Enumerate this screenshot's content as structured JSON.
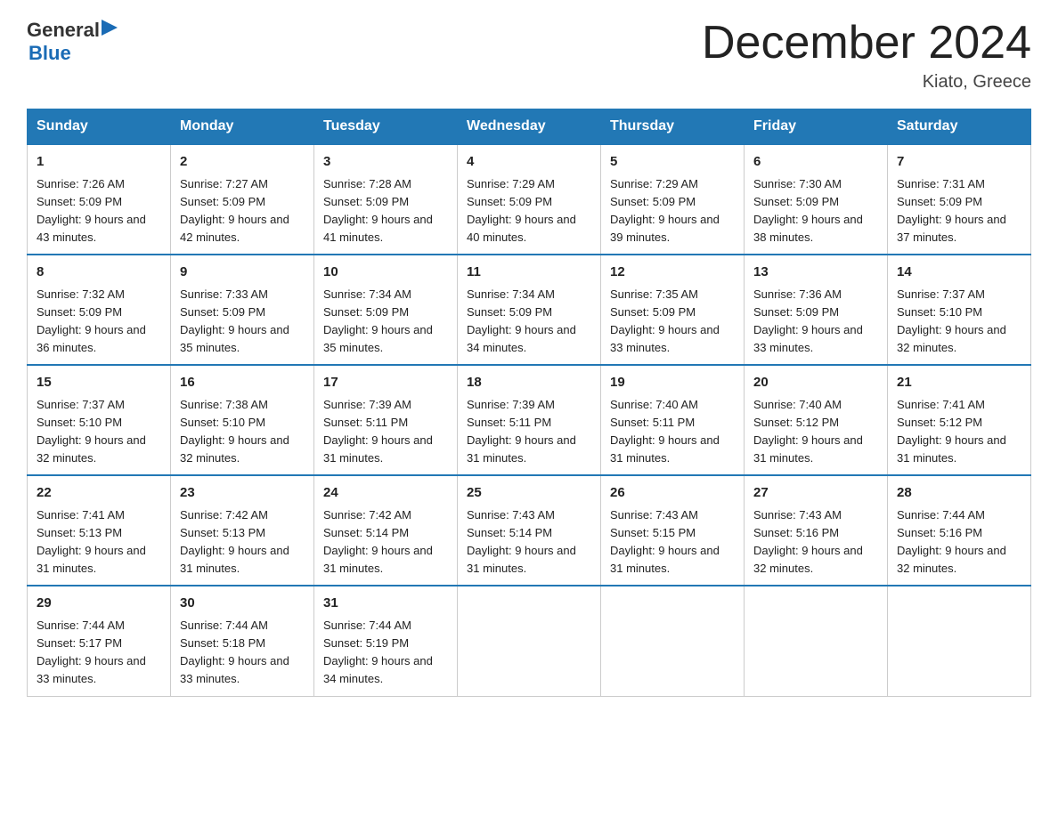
{
  "header": {
    "logo_general": "General",
    "logo_blue": "Blue",
    "title": "December 2024",
    "subtitle": "Kiato, Greece"
  },
  "columns": [
    "Sunday",
    "Monday",
    "Tuesday",
    "Wednesday",
    "Thursday",
    "Friday",
    "Saturday"
  ],
  "weeks": [
    [
      {
        "day": "1",
        "sunrise": "7:26 AM",
        "sunset": "5:09 PM",
        "daylight": "9 hours and 43 minutes."
      },
      {
        "day": "2",
        "sunrise": "7:27 AM",
        "sunset": "5:09 PM",
        "daylight": "9 hours and 42 minutes."
      },
      {
        "day": "3",
        "sunrise": "7:28 AM",
        "sunset": "5:09 PM",
        "daylight": "9 hours and 41 minutes."
      },
      {
        "day": "4",
        "sunrise": "7:29 AM",
        "sunset": "5:09 PM",
        "daylight": "9 hours and 40 minutes."
      },
      {
        "day": "5",
        "sunrise": "7:29 AM",
        "sunset": "5:09 PM",
        "daylight": "9 hours and 39 minutes."
      },
      {
        "day": "6",
        "sunrise": "7:30 AM",
        "sunset": "5:09 PM",
        "daylight": "9 hours and 38 minutes."
      },
      {
        "day": "7",
        "sunrise": "7:31 AM",
        "sunset": "5:09 PM",
        "daylight": "9 hours and 37 minutes."
      }
    ],
    [
      {
        "day": "8",
        "sunrise": "7:32 AM",
        "sunset": "5:09 PM",
        "daylight": "9 hours and 36 minutes."
      },
      {
        "day": "9",
        "sunrise": "7:33 AM",
        "sunset": "5:09 PM",
        "daylight": "9 hours and 35 minutes."
      },
      {
        "day": "10",
        "sunrise": "7:34 AM",
        "sunset": "5:09 PM",
        "daylight": "9 hours and 35 minutes."
      },
      {
        "day": "11",
        "sunrise": "7:34 AM",
        "sunset": "5:09 PM",
        "daylight": "9 hours and 34 minutes."
      },
      {
        "day": "12",
        "sunrise": "7:35 AM",
        "sunset": "5:09 PM",
        "daylight": "9 hours and 33 minutes."
      },
      {
        "day": "13",
        "sunrise": "7:36 AM",
        "sunset": "5:09 PM",
        "daylight": "9 hours and 33 minutes."
      },
      {
        "day": "14",
        "sunrise": "7:37 AM",
        "sunset": "5:10 PM",
        "daylight": "9 hours and 32 minutes."
      }
    ],
    [
      {
        "day": "15",
        "sunrise": "7:37 AM",
        "sunset": "5:10 PM",
        "daylight": "9 hours and 32 minutes."
      },
      {
        "day": "16",
        "sunrise": "7:38 AM",
        "sunset": "5:10 PM",
        "daylight": "9 hours and 32 minutes."
      },
      {
        "day": "17",
        "sunrise": "7:39 AM",
        "sunset": "5:11 PM",
        "daylight": "9 hours and 31 minutes."
      },
      {
        "day": "18",
        "sunrise": "7:39 AM",
        "sunset": "5:11 PM",
        "daylight": "9 hours and 31 minutes."
      },
      {
        "day": "19",
        "sunrise": "7:40 AM",
        "sunset": "5:11 PM",
        "daylight": "9 hours and 31 minutes."
      },
      {
        "day": "20",
        "sunrise": "7:40 AM",
        "sunset": "5:12 PM",
        "daylight": "9 hours and 31 minutes."
      },
      {
        "day": "21",
        "sunrise": "7:41 AM",
        "sunset": "5:12 PM",
        "daylight": "9 hours and 31 minutes."
      }
    ],
    [
      {
        "day": "22",
        "sunrise": "7:41 AM",
        "sunset": "5:13 PM",
        "daylight": "9 hours and 31 minutes."
      },
      {
        "day": "23",
        "sunrise": "7:42 AM",
        "sunset": "5:13 PM",
        "daylight": "9 hours and 31 minutes."
      },
      {
        "day": "24",
        "sunrise": "7:42 AM",
        "sunset": "5:14 PM",
        "daylight": "9 hours and 31 minutes."
      },
      {
        "day": "25",
        "sunrise": "7:43 AM",
        "sunset": "5:14 PM",
        "daylight": "9 hours and 31 minutes."
      },
      {
        "day": "26",
        "sunrise": "7:43 AM",
        "sunset": "5:15 PM",
        "daylight": "9 hours and 31 minutes."
      },
      {
        "day": "27",
        "sunrise": "7:43 AM",
        "sunset": "5:16 PM",
        "daylight": "9 hours and 32 minutes."
      },
      {
        "day": "28",
        "sunrise": "7:44 AM",
        "sunset": "5:16 PM",
        "daylight": "9 hours and 32 minutes."
      }
    ],
    [
      {
        "day": "29",
        "sunrise": "7:44 AM",
        "sunset": "5:17 PM",
        "daylight": "9 hours and 33 minutes."
      },
      {
        "day": "30",
        "sunrise": "7:44 AM",
        "sunset": "5:18 PM",
        "daylight": "9 hours and 33 minutes."
      },
      {
        "day": "31",
        "sunrise": "7:44 AM",
        "sunset": "5:19 PM",
        "daylight": "9 hours and 34 minutes."
      },
      null,
      null,
      null,
      null
    ]
  ]
}
